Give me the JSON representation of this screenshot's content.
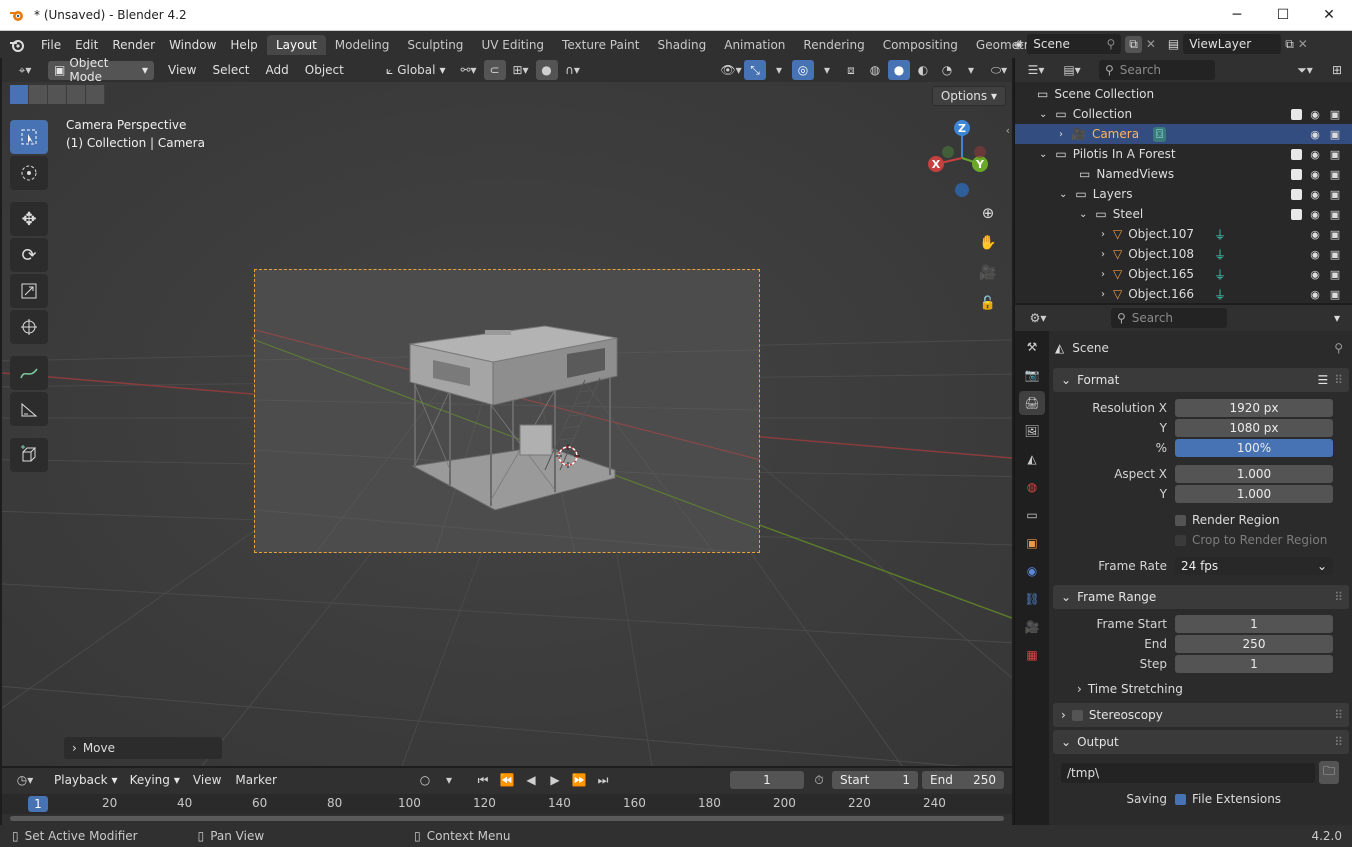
{
  "window": {
    "title": "* (Unsaved) - Blender 4.2"
  },
  "menubar": {
    "items": [
      "File",
      "Edit",
      "Render",
      "Window",
      "Help"
    ],
    "workspaces": [
      "Layout",
      "Modeling",
      "Sculpting",
      "UV Editing",
      "Texture Paint",
      "Shading",
      "Animation",
      "Rendering",
      "Compositing",
      "Geometry Nodes"
    ],
    "active_workspace": "Layout",
    "scene": "Scene",
    "view_layer": "ViewLayer"
  },
  "viewport": {
    "mode": "Object Mode",
    "menus": [
      "View",
      "Select",
      "Add",
      "Object"
    ],
    "orientation": "Global",
    "options_label": "Options",
    "info_line1": "Camera Perspective",
    "info_line2": "(1) Collection | Camera",
    "last_op": "Move",
    "gizmo": {
      "z": "Z",
      "y": "Y",
      "x": "X"
    }
  },
  "outliner": {
    "search_placeholder": "Search",
    "rows": [
      {
        "label": "Scene Collection",
        "indent": 0
      },
      {
        "label": "Collection",
        "indent": 1
      },
      {
        "label": "Camera",
        "indent": 2,
        "selected": true
      },
      {
        "label": "Pilotis In A Forest",
        "indent": 1
      },
      {
        "label": "NamedViews",
        "indent": 2
      },
      {
        "label": "Layers",
        "indent": 2
      },
      {
        "label": "Steel",
        "indent": 3
      },
      {
        "label": "Object.107",
        "indent": 4
      },
      {
        "label": "Object.108",
        "indent": 4
      },
      {
        "label": "Object.165",
        "indent": 4
      },
      {
        "label": "Object.166",
        "indent": 4
      }
    ]
  },
  "properties": {
    "search_placeholder": "Search",
    "context": "Scene",
    "format": {
      "title": "Format",
      "res_x_label": "Resolution X",
      "res_x": "1920 px",
      "res_y_label": "Y",
      "res_y": "1080 px",
      "pct_label": "%",
      "pct": "100%",
      "aspect_x_label": "Aspect X",
      "aspect_x": "1.000",
      "aspect_y_label": "Y",
      "aspect_y": "1.000",
      "render_region": "Render Region",
      "crop_region": "Crop to Render Region",
      "frame_rate_label": "Frame Rate",
      "frame_rate": "24 fps"
    },
    "frame_range": {
      "title": "Frame Range",
      "start_label": "Frame Start",
      "start": "1",
      "end_label": "End",
      "end": "250",
      "step_label": "Step",
      "step": "1",
      "time_stretching": "Time Stretching"
    },
    "stereoscopy": "Stereoscopy",
    "output": {
      "title": "Output",
      "path": "/tmp\\",
      "saving_label": "Saving",
      "file_ext": "File Extensions"
    }
  },
  "timeline": {
    "menus": [
      "Playback",
      "Keying",
      "View",
      "Marker"
    ],
    "current_frame": "1",
    "start_label": "Start",
    "start": "1",
    "end_label": "End",
    "end": "250",
    "ruler": [
      "1",
      "20",
      "40",
      "60",
      "80",
      "100",
      "120",
      "140",
      "160",
      "180",
      "200",
      "220",
      "240"
    ]
  },
  "statusbar": {
    "hint1": "Set Active Modifier",
    "hint2": "Pan View",
    "hint3": "Context Menu",
    "version": "4.2.0"
  }
}
